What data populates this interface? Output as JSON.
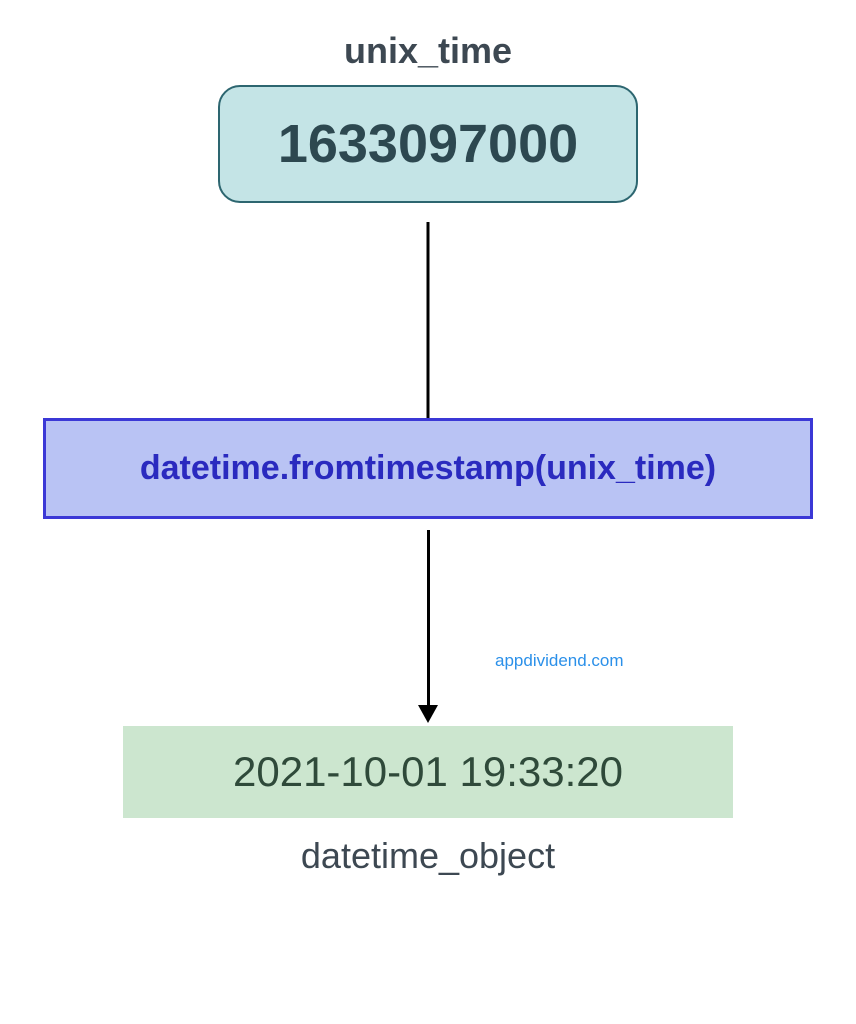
{
  "diagram": {
    "input_label": "unix_time",
    "input_value": "1633097000",
    "function_call": "datetime.fromtimestamp(unix_time)",
    "output_value": "2021-10-01 19:33:20",
    "output_label": "datetime_object",
    "watermark": "appdividend.com"
  }
}
